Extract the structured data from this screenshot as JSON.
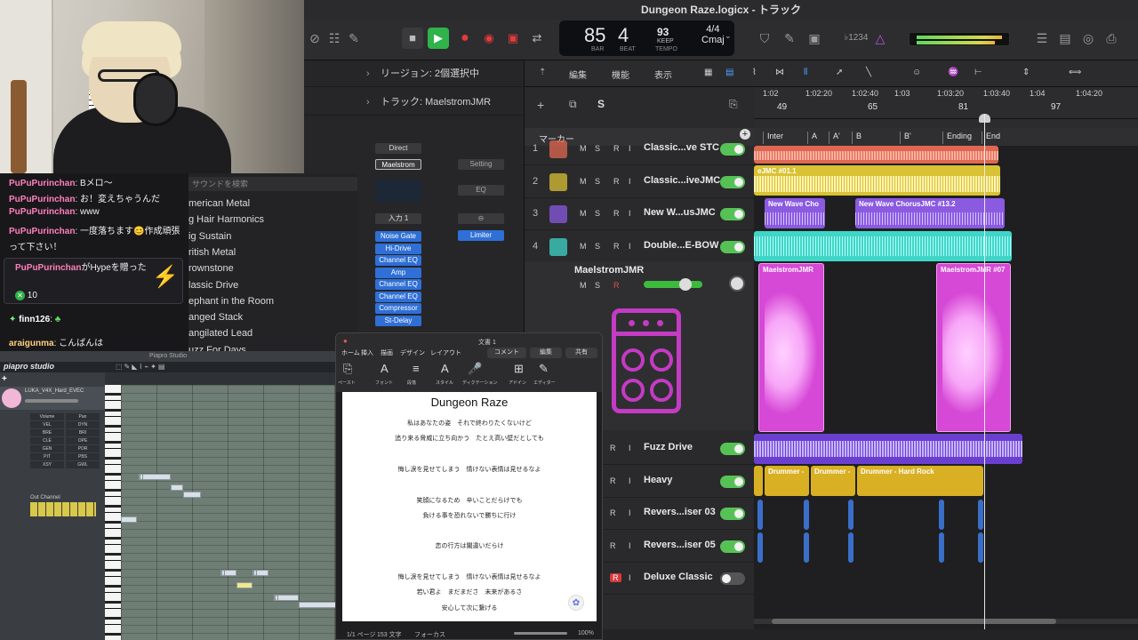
{
  "window": {
    "title": "Dungeon Raze.logicx - トラック"
  },
  "lcd": {
    "bar": "85",
    "beat": "4",
    "bar_label": "BAR",
    "beat_label": "BEAT",
    "tempo": "93",
    "keep": "KEEP",
    "tempo_label": "TEMPO",
    "time_sig": "4/4",
    "key": "Cmaj"
  },
  "control": {
    "count_in": "♭1234"
  },
  "inspector": {
    "region_label": "リージョン: 2個選択中",
    "track_label": "トラック: MaelstromJMR",
    "direct": "Direct",
    "instrument": "Maelstrom",
    "setting": "Setting",
    "eq": "EQ",
    "input": "入力 1",
    "plugins": [
      "Noise Gate",
      "Hi-Drive",
      "Channel EQ",
      "Amp",
      "Channel EQ",
      "Channel EQ",
      "Compressor",
      "St-Delay"
    ],
    "sends": [
      "Limiter"
    ]
  },
  "toolbar": {
    "edit": "編集",
    "function": "機能",
    "view": "表示"
  },
  "marker_header": "マーカー",
  "ruler": {
    "times": [
      "1:02",
      "1:02:20",
      "1:02:40",
      "1:03",
      "1:03:20",
      "1:03:40",
      "1:04",
      "1:04:20"
    ],
    "bars": [
      "49",
      "65",
      "81",
      "97"
    ]
  },
  "markers": [
    "Inter",
    "A",
    "A'",
    "B",
    "B'",
    "Ending",
    "End"
  ],
  "tracks": [
    {
      "num": "1",
      "name": "Classic...ve STC",
      "color": "#e06850"
    },
    {
      "num": "2",
      "name": "Classic...iveJMC",
      "color": "#d9c234"
    },
    {
      "num": "3",
      "name": "New W...usJMC",
      "color": "#8a5ae0"
    },
    {
      "num": "4",
      "name": "Double...E-BOW",
      "color": "#3fd6c8"
    }
  ],
  "selected_track": {
    "name": "MaelstromJMR"
  },
  "lower_tracks": [
    {
      "name": "Fuzz Drive"
    },
    {
      "name": "Heavy"
    },
    {
      "name": "Revers...iser 03"
    },
    {
      "name": "Revers...iser 05"
    },
    {
      "name": "Deluxe Classic"
    }
  ],
  "regions": {
    "t2": "eJMC #01.1",
    "t3a": "New Wave Cho",
    "t3b": "New Wave ChorusJMC #13.2",
    "m1": "MaelstromJMR",
    "m2": "MaelstromJMR #07",
    "d1": "Drummer -",
    "d2": "Drummer -",
    "d3": "Drummer - Hard Rock"
  },
  "chat": {
    "lines": [
      {
        "user": "PuPuPurinchan",
        "text": ": Bメロ～"
      },
      {
        "user": "PuPuPurinchan",
        "text": ": お！変えちゃうんだ"
      },
      {
        "user": "PuPuPurinchan",
        "text": ": www"
      },
      {
        "user": "PuPuPurinchan",
        "text": ": 一度落ちます😊作成頑張"
      },
      {
        "user": "",
        "text": "って下さい！"
      }
    ],
    "hype_user": "PuPuPurinchan",
    "hype_text": "がHypeを贈った",
    "hype_count": "10",
    "line6_user": "finn126",
    "line6_text": ":",
    "line7_user": "araigunma",
    "line7_text": ": こんばんは"
  },
  "sounds": {
    "search_placeholder": "サウンドを検索",
    "items": [
      "merican Metal",
      "g Hair Harmonics",
      "ig Sustain",
      "ritish Metal",
      "rownstone",
      "lassic Drive",
      "ephant in the Room",
      "anged Stack",
      "angilated Lead",
      "uzz For Days"
    ]
  },
  "piapro": {
    "window_title": "Piapro Studio",
    "logo": "piapro studio",
    "track_name": "LUKA_V4X_Hard_EVEC",
    "params": [
      "Volume",
      "Pan",
      "VEL",
      "DYN",
      "BRE",
      "BRI",
      "CLE",
      "OPE",
      "GEN",
      "POR",
      "PIT",
      "PBS",
      "XSY",
      "GWL"
    ],
    "out_channel": "Out Channel",
    "notes": [
      "[ ]",
      "[ ]",
      "[ ]",
      "[ ]"
    ]
  },
  "pages": {
    "toolbar_items": [
      "ホーム",
      "挿入",
      "描画",
      "デザイン",
      "レイアウト"
    ],
    "comment": "コメント",
    "edit": "編集",
    "share": "共有",
    "doc_name": "文書 1",
    "ribbon": [
      "ペースト",
      "フォント",
      "段落",
      "スタイル",
      "ディクテーション",
      "アドイン",
      "エディター"
    ],
    "title": "Dungeon Raze",
    "lyrics": [
      "私はあなたの姿　それで終わりたくないけど",
      "追り来る脅威に立ち向かう　たとえ高い壁だとしても",
      "",
      "悔し涙を見せてしまう　情けない表情は見せるなよ",
      "",
      "笑顔になるため　辛いことだらけでも",
      "負ける事を恐れないで勝ちに行け",
      "",
      "恋の行方は闇違いだらけ",
      "",
      "悔し涙を見せてしまう　情けない表情は見せるなよ",
      "若い君よ　まだまださ　未来があるさ",
      "安心して次に繋げる"
    ],
    "status_page": "1/1 ページ",
    "status_chars": "153 文字",
    "focus": "フォーカス",
    "zoom": "100%"
  }
}
